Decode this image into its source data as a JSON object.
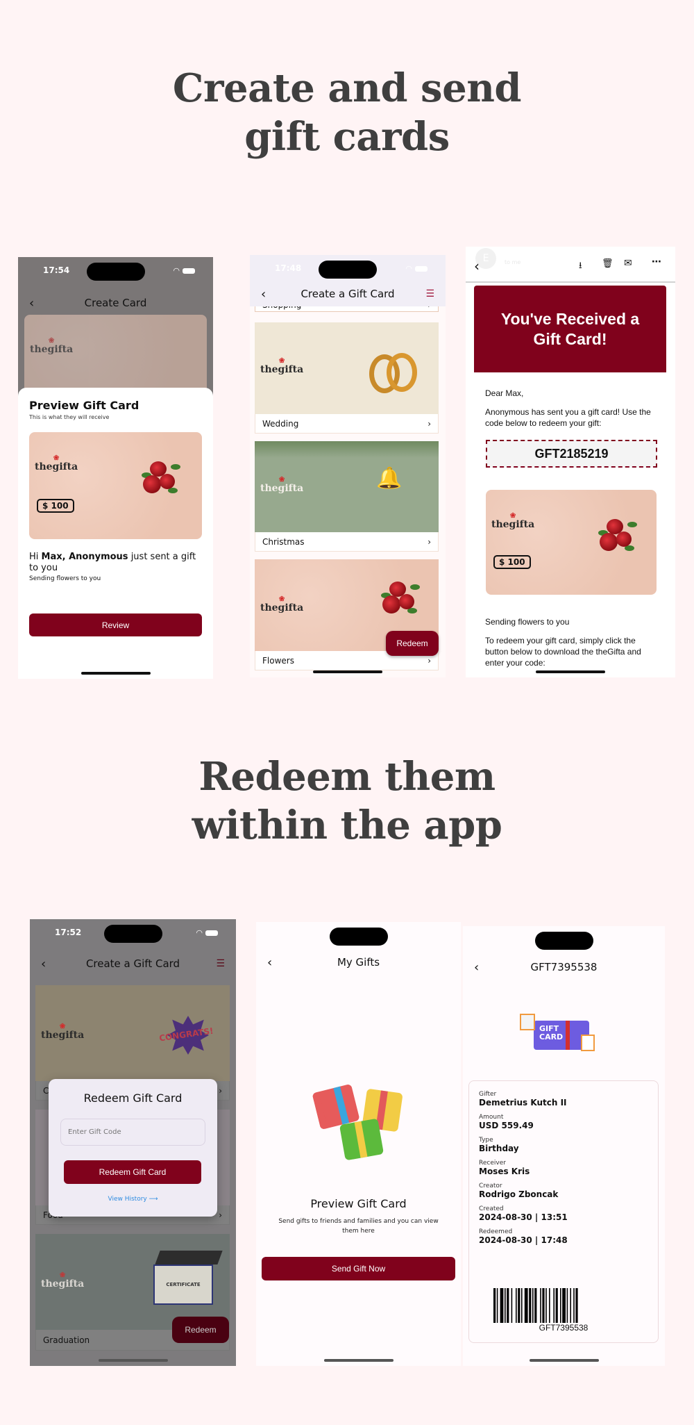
{
  "headings": {
    "create": [
      "Create and send",
      "gift cards"
    ],
    "redeem": [
      "Redeem them",
      "within the app"
    ]
  },
  "colors": {
    "page_bg": "#fff4f5",
    "brand": "#80021c",
    "heading": "#3f3f3f",
    "link": "#2d8be0"
  },
  "brand_logo": "thegifta",
  "phone1": {
    "time": "17:54",
    "title": "Create Card",
    "sheet_title": "Preview Gift Card",
    "sheet_subtitle": "This is what they will receive",
    "amount": "$ 100",
    "message_hi": "Hi ",
    "message_receiver": "Max,",
    "message_sender": " Anonymous",
    "message_rest": " just sent a gift to you",
    "note": "Sending flowers to you",
    "button": "Review"
  },
  "phone2": {
    "time": "17:48",
    "title": "Create a Gift Card",
    "partial_category": "Shopping",
    "categories": [
      "Wedding",
      "Christmas",
      "Flowers"
    ],
    "fab": "Redeem"
  },
  "phone3": {
    "sender_initial": "E",
    "to_line": "to me",
    "banner": "You've Received a Gift Card!",
    "greeting": "Dear Max,",
    "intro": "Anonymous has sent you a gift card! Use the code below to redeem your gift:",
    "code": "GFT2185219",
    "amount": "$ 100",
    "note": "Sending flowers to you",
    "instructions": "To redeem your gift card, simply click the button below to download the theGifta and enter your code:"
  },
  "phone4": {
    "time": "17:52",
    "title": "Create a Gift Card",
    "categories": [
      "Congrats",
      "Food",
      "Graduation"
    ],
    "modal_title": "Redeem Gift Card",
    "input_placeholder": "Enter Gift Code",
    "modal_button": "Redeem Gift Card",
    "history_link": "View History",
    "fab": "Redeem",
    "certificate_text": "CERTIFICATE",
    "congrats_text": "CONGRATS!"
  },
  "phone5": {
    "title": "My Gifts",
    "empty_title": "Preview Gift Card",
    "empty_text": "Send gifts to friends and families and you can view them here",
    "button": "Send Gift Now"
  },
  "phone6": {
    "title": "GFT7395538",
    "illustration_text": [
      "GIFT",
      "CARD"
    ],
    "fields": [
      {
        "label": "Gifter",
        "value": "Demetrius Kutch II"
      },
      {
        "label": "Amount",
        "value": "USD 559.49"
      },
      {
        "label": "Type",
        "value": "Birthday"
      },
      {
        "label": "Receiver",
        "value": "Moses Kris"
      },
      {
        "label": "Creator",
        "value": "Rodrigo Zboncak"
      },
      {
        "label": "Created",
        "value": "2024-08-30 | 13:51"
      },
      {
        "label": "Redeemed",
        "value": "2024-08-30 | 17:48"
      }
    ],
    "barcode_text": "GFT7395538"
  }
}
